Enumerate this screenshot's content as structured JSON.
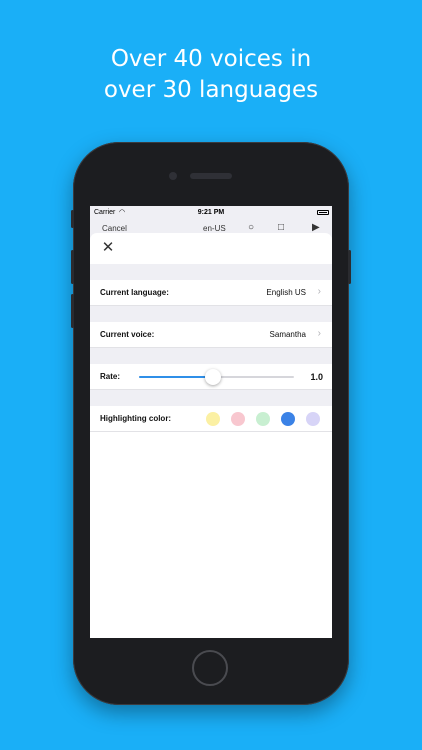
{
  "headline": {
    "line1": "Over 40 voices in",
    "line2": "over 30 languages"
  },
  "status_bar": {
    "carrier": "Carrier",
    "time": "9:21 PM"
  },
  "nav_peek": {
    "cancel": "Cancel",
    "language": "en-US"
  },
  "settings": {
    "close_icon": "close-icon",
    "current_language": {
      "label": "Current language:",
      "value": "English US"
    },
    "current_voice": {
      "label": "Current voice:",
      "value": "Samantha"
    },
    "rate": {
      "label": "Rate:",
      "value": "1.0",
      "fraction": 0.48
    },
    "highlighting": {
      "label": "Highlighting color:",
      "colors": [
        "#fbf0a3",
        "#f8c7cf",
        "#c8efd1",
        "#3b82e6",
        "#d7d4f7"
      ],
      "selected_index": 3
    }
  },
  "colors": {
    "background": "#1aaff7",
    "accent": "#2f8fe8"
  }
}
